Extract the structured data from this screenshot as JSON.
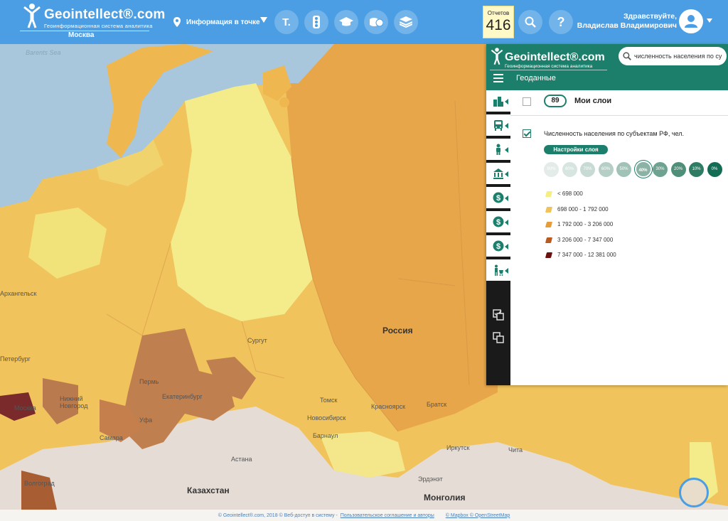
{
  "header": {
    "logo_title": "Geointellect®.com",
    "logo_subtitle": "Геоинформационная система аналитика",
    "city": "Москва",
    "info_point_label": "Информация в точке",
    "reports_label": "Отчетов",
    "reports_count": "416",
    "greeting_line1": "Здравствуйте,",
    "greeting_line2": "Владислав Владимирович",
    "tool_icons": [
      "t-icon",
      "traffic-light-icon",
      "graduation-cap-icon",
      "coins-icon",
      "layers-icon"
    ],
    "background_color": "#4b9ee3"
  },
  "map": {
    "labels": {
      "sea": "Barents Sea",
      "russia": "Россия",
      "kazakhstan": "Казахстан",
      "mongolia": "Монголия",
      "arkhangelsk": "Архангельск",
      "petersburg": "Петербург",
      "moscow": "Москва",
      "nizhny": "Нижний\nНовгород",
      "perm": "Пермь",
      "ekb": "Екатеринбург",
      "surgut": "Сургут",
      "samara": "Самара",
      "ufa": "Уфа",
      "volgograd": "Волгоград",
      "astana": "Астана",
      "tomsk": "Томск",
      "novosibirsk": "Новосибирск",
      "barnaul": "Барнаул",
      "krasnoyarsk": "Красноярск",
      "bratsk": "Братск",
      "irkutsk": "Иркутск",
      "chita": "Чита",
      "erdenet": "Эрдэнэт"
    },
    "footer": {
      "copyright": "© Geointellect®.com, 2018 © Веб-доступ в систему -",
      "terms_link": "Пользовательское соглашение и авторы",
      "mapbox_link": "© Mapbox © OpenStreetMap"
    }
  },
  "panel": {
    "logo_title": "Geointellect®.com",
    "logo_subtitle": "Геоинформационная система аналитика",
    "search_value": "численность населения по су",
    "tab_title": "Геоданные",
    "side_tab_icons": [
      "city-buildings-icon",
      "bus-icon",
      "person-icon",
      "bank-icon",
      "dollar-icon",
      "dollar-icon",
      "dollar-icon",
      "shopper-icon"
    ],
    "side_button_icons": [
      "select-checkbox-icon",
      "copy-squares-icon"
    ],
    "my_layers_count": "89",
    "my_layers_title": "Мои слои",
    "layer": {
      "title": "Численность населения по субъектам РФ, чел.",
      "checked": true,
      "settings_label": "Настройки слоя",
      "opacity_options": [
        "90%",
        "80%",
        "70%",
        "60%",
        "50%",
        "40%",
        "30%",
        "20%",
        "10%",
        "0%"
      ],
      "opacity_selected": "40%",
      "opacity_colors": [
        "#e3ece9",
        "#d6e5e0",
        "#c7dbd4",
        "#b5cfc6",
        "#a1c2b6",
        "#8ab3a5",
        "#6fa391",
        "#4f8f79",
        "#2f7c65",
        "#136d55"
      ]
    },
    "legend": [
      {
        "label": "< 698 000",
        "color": "#f6ee80"
      },
      {
        "label": "698 000 - 1 792 000",
        "color": "#f1c25a"
      },
      {
        "label": "1 792 000 - 3 206 000",
        "color": "#e79c3a"
      },
      {
        "label": "3 206 000 - 7 347 000",
        "color": "#b95a1f"
      },
      {
        "label": "7 347 000 - 12 381 000",
        "color": "#6e0f0f"
      }
    ],
    "accent_color": "#1c7f6b"
  }
}
